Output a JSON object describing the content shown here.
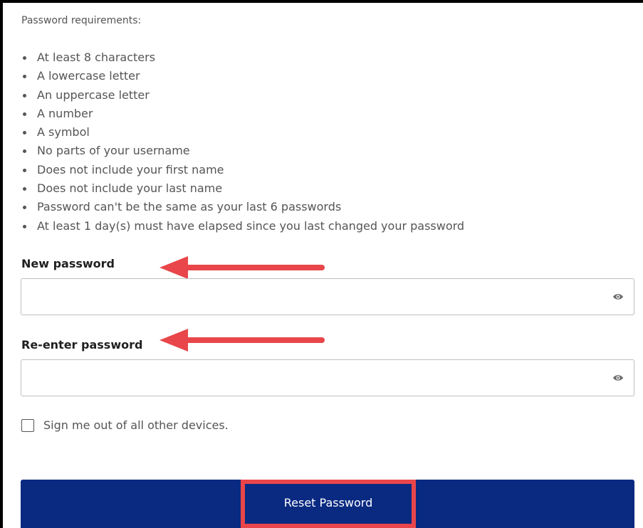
{
  "requirements": {
    "heading": "Password requirements:",
    "items": [
      "At least 8 characters",
      "A lowercase letter",
      "An uppercase letter",
      "A number",
      "A symbol",
      "No parts of your username",
      "Does not include your first name",
      "Does not include your last name",
      "Password can't be the same as your last 6 passwords",
      "At least 1 day(s) must have elapsed since you last changed your password"
    ]
  },
  "new_password": {
    "label": "New password",
    "value": "",
    "icon": "eye-icon"
  },
  "reenter_password": {
    "label": "Re-enter password",
    "value": "",
    "icon": "eye-icon"
  },
  "sign_out": {
    "label": "Sign me out of all other devices.",
    "checked": false
  },
  "reset_button": {
    "label": "Reset Password"
  },
  "colors": {
    "button_bg": "#0a2a82",
    "annotation": "#e8464a"
  }
}
